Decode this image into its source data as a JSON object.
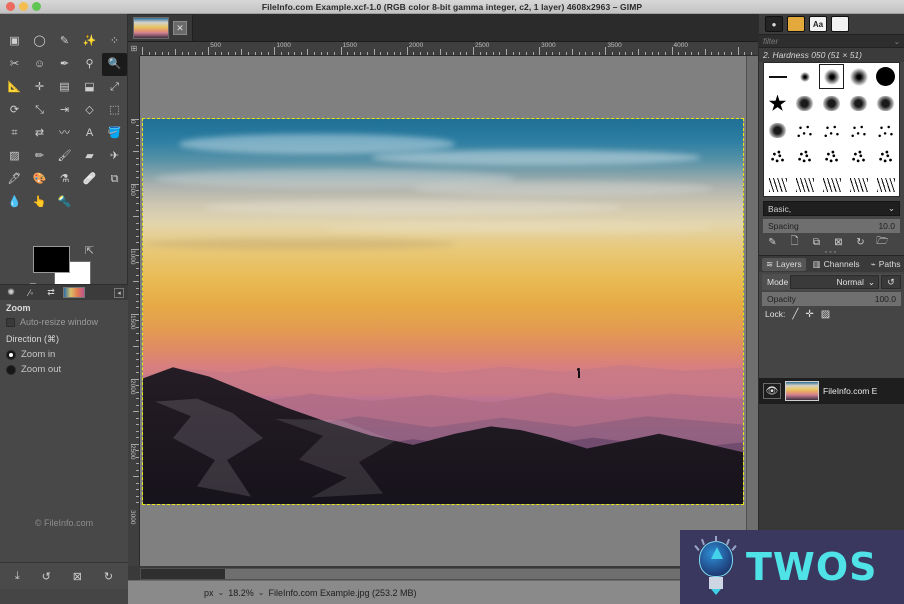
{
  "window": {
    "title": "FileInfo.com Example.xcf-1.0 (RGB color 8-bit gamma integer, c2, 1 layer) 4608x2963 – GIMP",
    "traffic_lights": [
      "close",
      "minimize",
      "zoom"
    ]
  },
  "toolbox": {
    "tools": [
      {
        "name": "rect-select-tool",
        "glyph": "▣"
      },
      {
        "name": "ellipse-select-tool",
        "glyph": "◯"
      },
      {
        "name": "free-select-tool",
        "glyph": "✎"
      },
      {
        "name": "fuzzy-select-tool",
        "glyph": "✨"
      },
      {
        "name": "select-by-color-tool",
        "glyph": "⁘"
      },
      {
        "name": "scissors-select-tool",
        "glyph": "✂"
      },
      {
        "name": "foreground-select-tool",
        "glyph": "☺"
      },
      {
        "name": "paths-tool",
        "glyph": "✒"
      },
      {
        "name": "color-picker-tool",
        "glyph": "⚲"
      },
      {
        "name": "zoom-tool",
        "glyph": "🔍",
        "selected": true
      },
      {
        "name": "measure-tool",
        "glyph": "📐"
      },
      {
        "name": "move-tool",
        "glyph": "✛"
      },
      {
        "name": "alignment-tool",
        "glyph": "▤"
      },
      {
        "name": "crop-tool",
        "glyph": "⬓"
      },
      {
        "name": "transform-tool",
        "glyph": "⤢"
      },
      {
        "name": "rotate-tool",
        "glyph": "⟳"
      },
      {
        "name": "scale-tool",
        "glyph": "⤡"
      },
      {
        "name": "shear-tool",
        "glyph": "⇥"
      },
      {
        "name": "perspective-tool",
        "glyph": "◇"
      },
      {
        "name": "unified-transform-tool",
        "glyph": "⬚"
      },
      {
        "name": "handle-transform-tool",
        "glyph": "⌗"
      },
      {
        "name": "flip-tool",
        "glyph": "⇄"
      },
      {
        "name": "warp-tool",
        "glyph": "〰"
      },
      {
        "name": "text-tool",
        "glyph": "A"
      },
      {
        "name": "bucket-fill-tool",
        "glyph": "🪣"
      },
      {
        "name": "gradient-tool",
        "glyph": "▨"
      },
      {
        "name": "pencil-tool",
        "glyph": "✏"
      },
      {
        "name": "paintbrush-tool",
        "glyph": "🖌"
      },
      {
        "name": "eraser-tool",
        "glyph": "▰"
      },
      {
        "name": "airbrush-tool",
        "glyph": "✈"
      },
      {
        "name": "ink-tool",
        "glyph": "🖋"
      },
      {
        "name": "mypaint-brush-tool",
        "glyph": "🎨"
      },
      {
        "name": "clone-tool",
        "glyph": "⚗"
      },
      {
        "name": "heal-tool",
        "glyph": "🩹"
      },
      {
        "name": "perspective-clone-tool",
        "glyph": "⧉"
      },
      {
        "name": "blur-sharpen-tool",
        "glyph": "💧"
      },
      {
        "name": "smudge-tool",
        "glyph": "👆"
      },
      {
        "name": "dodge-burn-tool",
        "glyph": "🔦"
      }
    ],
    "colors": {
      "foreground": "#000000",
      "background": "#ffffff",
      "swap_icon": "swap-colors-icon",
      "reset_icon": "reset-colors-icon"
    },
    "indicators": [
      "active-brush-icon",
      "active-pattern-icon",
      "active-gradient-icon"
    ],
    "bottom_buttons": [
      "save-icon",
      "undo-icon",
      "cancel-icon",
      "reset-icon"
    ],
    "watermark": "© FileInfo.com"
  },
  "tool_options": {
    "title": "Zoom",
    "auto_resize_label": "Auto-resize window",
    "direction_label": "Direction  (⌘)",
    "options": [
      {
        "label": "Zoom in",
        "selected": true
      },
      {
        "label": "Zoom out",
        "selected": false
      }
    ]
  },
  "image_window": {
    "tab": {
      "name": "image-tab",
      "close_label": "✕"
    },
    "ruler_h": {
      "labels": [
        "500",
        "1000",
        "1500",
        "2000",
        "2500",
        "3000",
        "3500",
        "4000"
      ]
    },
    "ruler_v": {
      "labels": [
        "0",
        "500",
        "1000",
        "1500",
        "2000",
        "2500",
        "3000"
      ]
    },
    "corner_icon": "ruler-origin-icon"
  },
  "status_bar": {
    "unit": "px",
    "unit_caret": "⌄",
    "zoom": "18.2%",
    "zoom_caret": "⌄",
    "filename": "FileInfo.com Example.jpg (253.2 MB)"
  },
  "dock": {
    "tabs": [
      {
        "name": "brushes-tab",
        "glyph": "●",
        "active": true
      },
      {
        "name": "patterns-tab",
        "glyph": ""
      },
      {
        "name": "fonts-tab",
        "glyph": "Aa"
      },
      {
        "name": "documents-tab",
        "glyph": ""
      }
    ],
    "filter_placeholder": "filter",
    "filter_caret": "⌄",
    "brush_name": "2. Hardness 050 (51 × 51)",
    "brush_list_label": "Basic,",
    "brush_list_caret": "⌄",
    "spacing_label": "Spacing",
    "spacing_value": "10.0",
    "brush_buttons": [
      "edit-brush-icon",
      "new-brush-icon",
      "duplicate-brush-icon",
      "delete-brush-icon",
      "refresh-brushes-icon",
      "open-brush-icon"
    ],
    "layer_tabs": [
      {
        "name": "layers-tab",
        "label": "Layers",
        "icon": "layers-icon",
        "active": true
      },
      {
        "name": "channels-tab",
        "label": "Channels",
        "icon": "channels-icon",
        "active": false
      },
      {
        "name": "paths-tab",
        "label": "Paths",
        "icon": "paths-icon",
        "active": false
      }
    ],
    "mode_label": "Mode",
    "mode_value": "Normal",
    "mode_caret": "⌄",
    "mode_reset_icon": "reset-mode-icon",
    "opacity_label": "Opacity",
    "opacity_value": "100.0",
    "lock_label": "Lock:",
    "lock_icons": [
      "lock-pixels-icon",
      "lock-position-icon",
      "lock-alpha-icon"
    ],
    "layers": [
      {
        "name": "FileInfo.com E",
        "visible": true,
        "visibility_icon": "eye-icon"
      }
    ]
  },
  "overlay": {
    "logo_text": "TWOS",
    "logo_icon": "lightbulb-icon"
  },
  "colors": {
    "accent": "#4fe3e8",
    "panel_bg": "#454545",
    "canvas_bg": "#808080",
    "selection_border": "#e8e80f"
  }
}
